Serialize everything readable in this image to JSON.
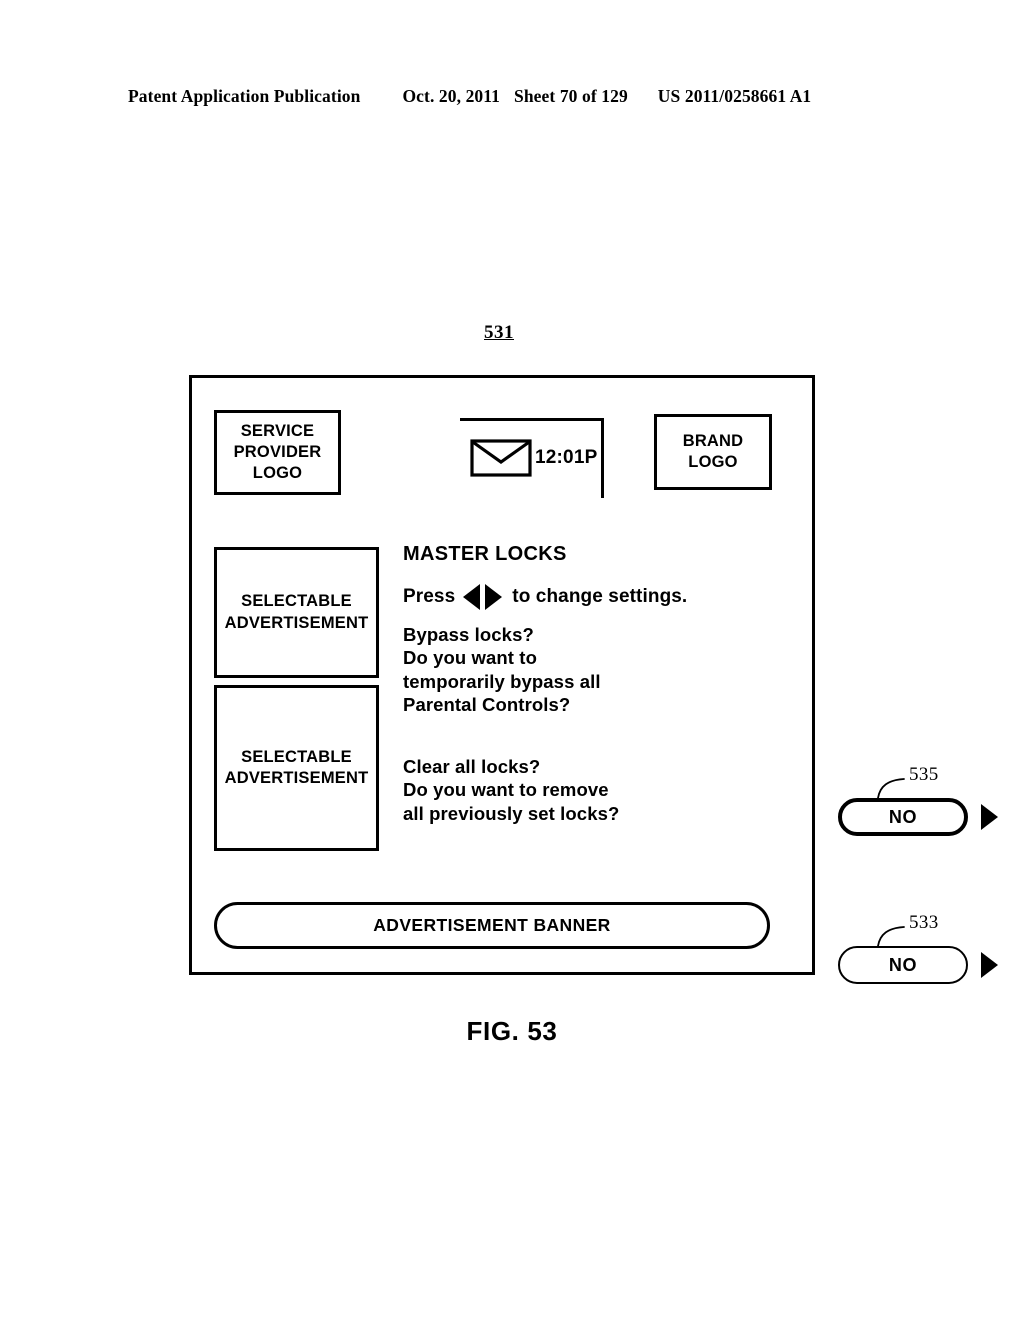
{
  "publication_header": {
    "title": "Patent Application Publication",
    "date": "Oct. 20, 2011",
    "sheet": "Sheet 70 of 129",
    "document_number": "US 2011/0258661 A1"
  },
  "figure": {
    "reference_numeral": "531",
    "caption": "FIG. 53"
  },
  "screen": {
    "service_provider_logo": {
      "line1": "SERVICE",
      "line2": "PROVIDER",
      "line3": "LOGO"
    },
    "status_bar": {
      "mail_icon": "envelope-icon",
      "time": "12:01P"
    },
    "brand_logo": {
      "line1": "BRAND",
      "line2": "LOGO"
    },
    "advertisements": [
      {
        "line1": "SELECTABLE",
        "line2": "ADVERTISEMENT"
      },
      {
        "line1": "SELECTABLE",
        "line2": "ADVERTISEMENT"
      }
    ],
    "main": {
      "section_title": "MASTER LOCKS",
      "instruction": {
        "prefix": "Press",
        "left_arrow": "left-triangle-icon",
        "right_arrow": "right-triangle-icon",
        "suffix": "to change settings."
      },
      "settings": [
        {
          "callout": "535",
          "question_lines": [
            "Bypass locks?",
            "Do you want to",
            "temporarily bypass all",
            "Parental Controls?"
          ],
          "value": "NO",
          "next_arrow": "right-triangle-icon"
        },
        {
          "callout": "533",
          "question_lines": [
            "Clear all locks?",
            "Do you want to remove",
            "all previously set locks?"
          ],
          "value": "NO",
          "next_arrow": "right-triangle-icon"
        }
      ]
    },
    "banner": {
      "label": "ADVERTISEMENT BANNER"
    }
  }
}
